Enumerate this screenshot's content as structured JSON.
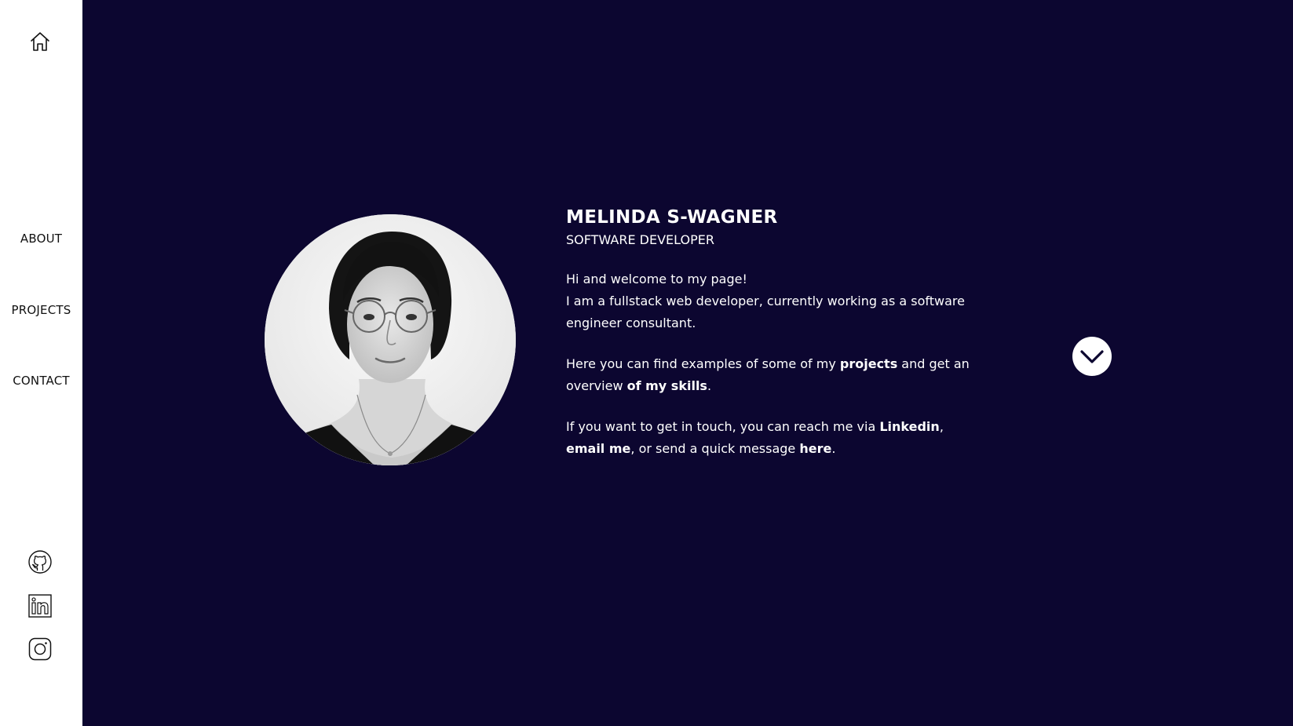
{
  "sidebar": {
    "home_icon": "home-icon",
    "nav": [
      {
        "label": "ABOUT"
      },
      {
        "label": "PROJECTS"
      },
      {
        "label": "CONTACT"
      }
    ],
    "social": [
      {
        "icon": "github-icon"
      },
      {
        "icon": "linkedin-icon"
      },
      {
        "icon": "instagram-icon"
      }
    ]
  },
  "profile": {
    "name": "MELINDA S-WAGNER",
    "role": "SOFTWARE DEVELOPER",
    "p1_line1": "Hi and welcome to my page!",
    "p1_line2": "I am a fullstack web developer, currently working as a software engineer consultant.",
    "p2_pre": "Here you can find examples of some of my ",
    "p2_link1": "projects",
    "p2_mid": " and get an overview ",
    "p2_link2": "of my skills",
    "p2_post": ".",
    "p3_pre": "If you want to get in touch, you can reach me via ",
    "p3_link1": "Linkedin",
    "p3_sep": ", ",
    "p3_link2": "email me",
    "p3_mid": ", or send a quick message ",
    "p3_link3": "here",
    "p3_post": "."
  },
  "scroll": {
    "icon": "chevron-down-icon"
  },
  "colors": {
    "background": "#0c0630",
    "sidebar": "#ffffff",
    "text": "#ffffff"
  }
}
